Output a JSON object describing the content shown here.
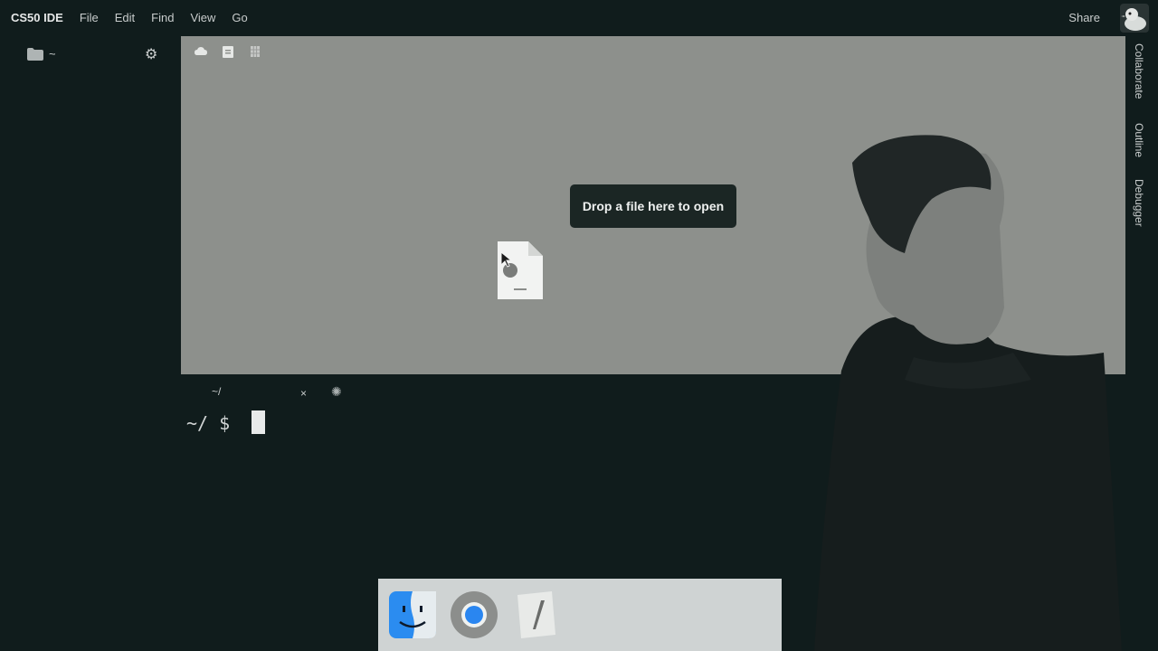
{
  "app": {
    "title": "CS50 IDE"
  },
  "menu": [
    {
      "label": "File"
    },
    {
      "label": "Edit"
    },
    {
      "label": "Find"
    },
    {
      "label": "View"
    },
    {
      "label": "Go"
    }
  ],
  "header": {
    "share_label": "Share"
  },
  "sidebar": {
    "folder_label": "~"
  },
  "editor": {
    "drop_message": "Drop a file here to open"
  },
  "right_panel": [
    {
      "label": "Collaborate"
    },
    {
      "label": "Outline"
    },
    {
      "label": "Debugger"
    }
  ],
  "terminal": {
    "tab_label": "~/",
    "close_label": "×",
    "prompt": "~/ $"
  },
  "icons": {
    "folder": "folder-icon",
    "gear": "gear-icon",
    "dock": [
      "finder-icon",
      "chrome-icon",
      "text-editor-icon"
    ]
  },
  "colors": {
    "background": "#101c1c",
    "editor_area": "#8d908c",
    "drop_label_bg": "#1b2624",
    "dock_bg": "#cfd3d3"
  }
}
